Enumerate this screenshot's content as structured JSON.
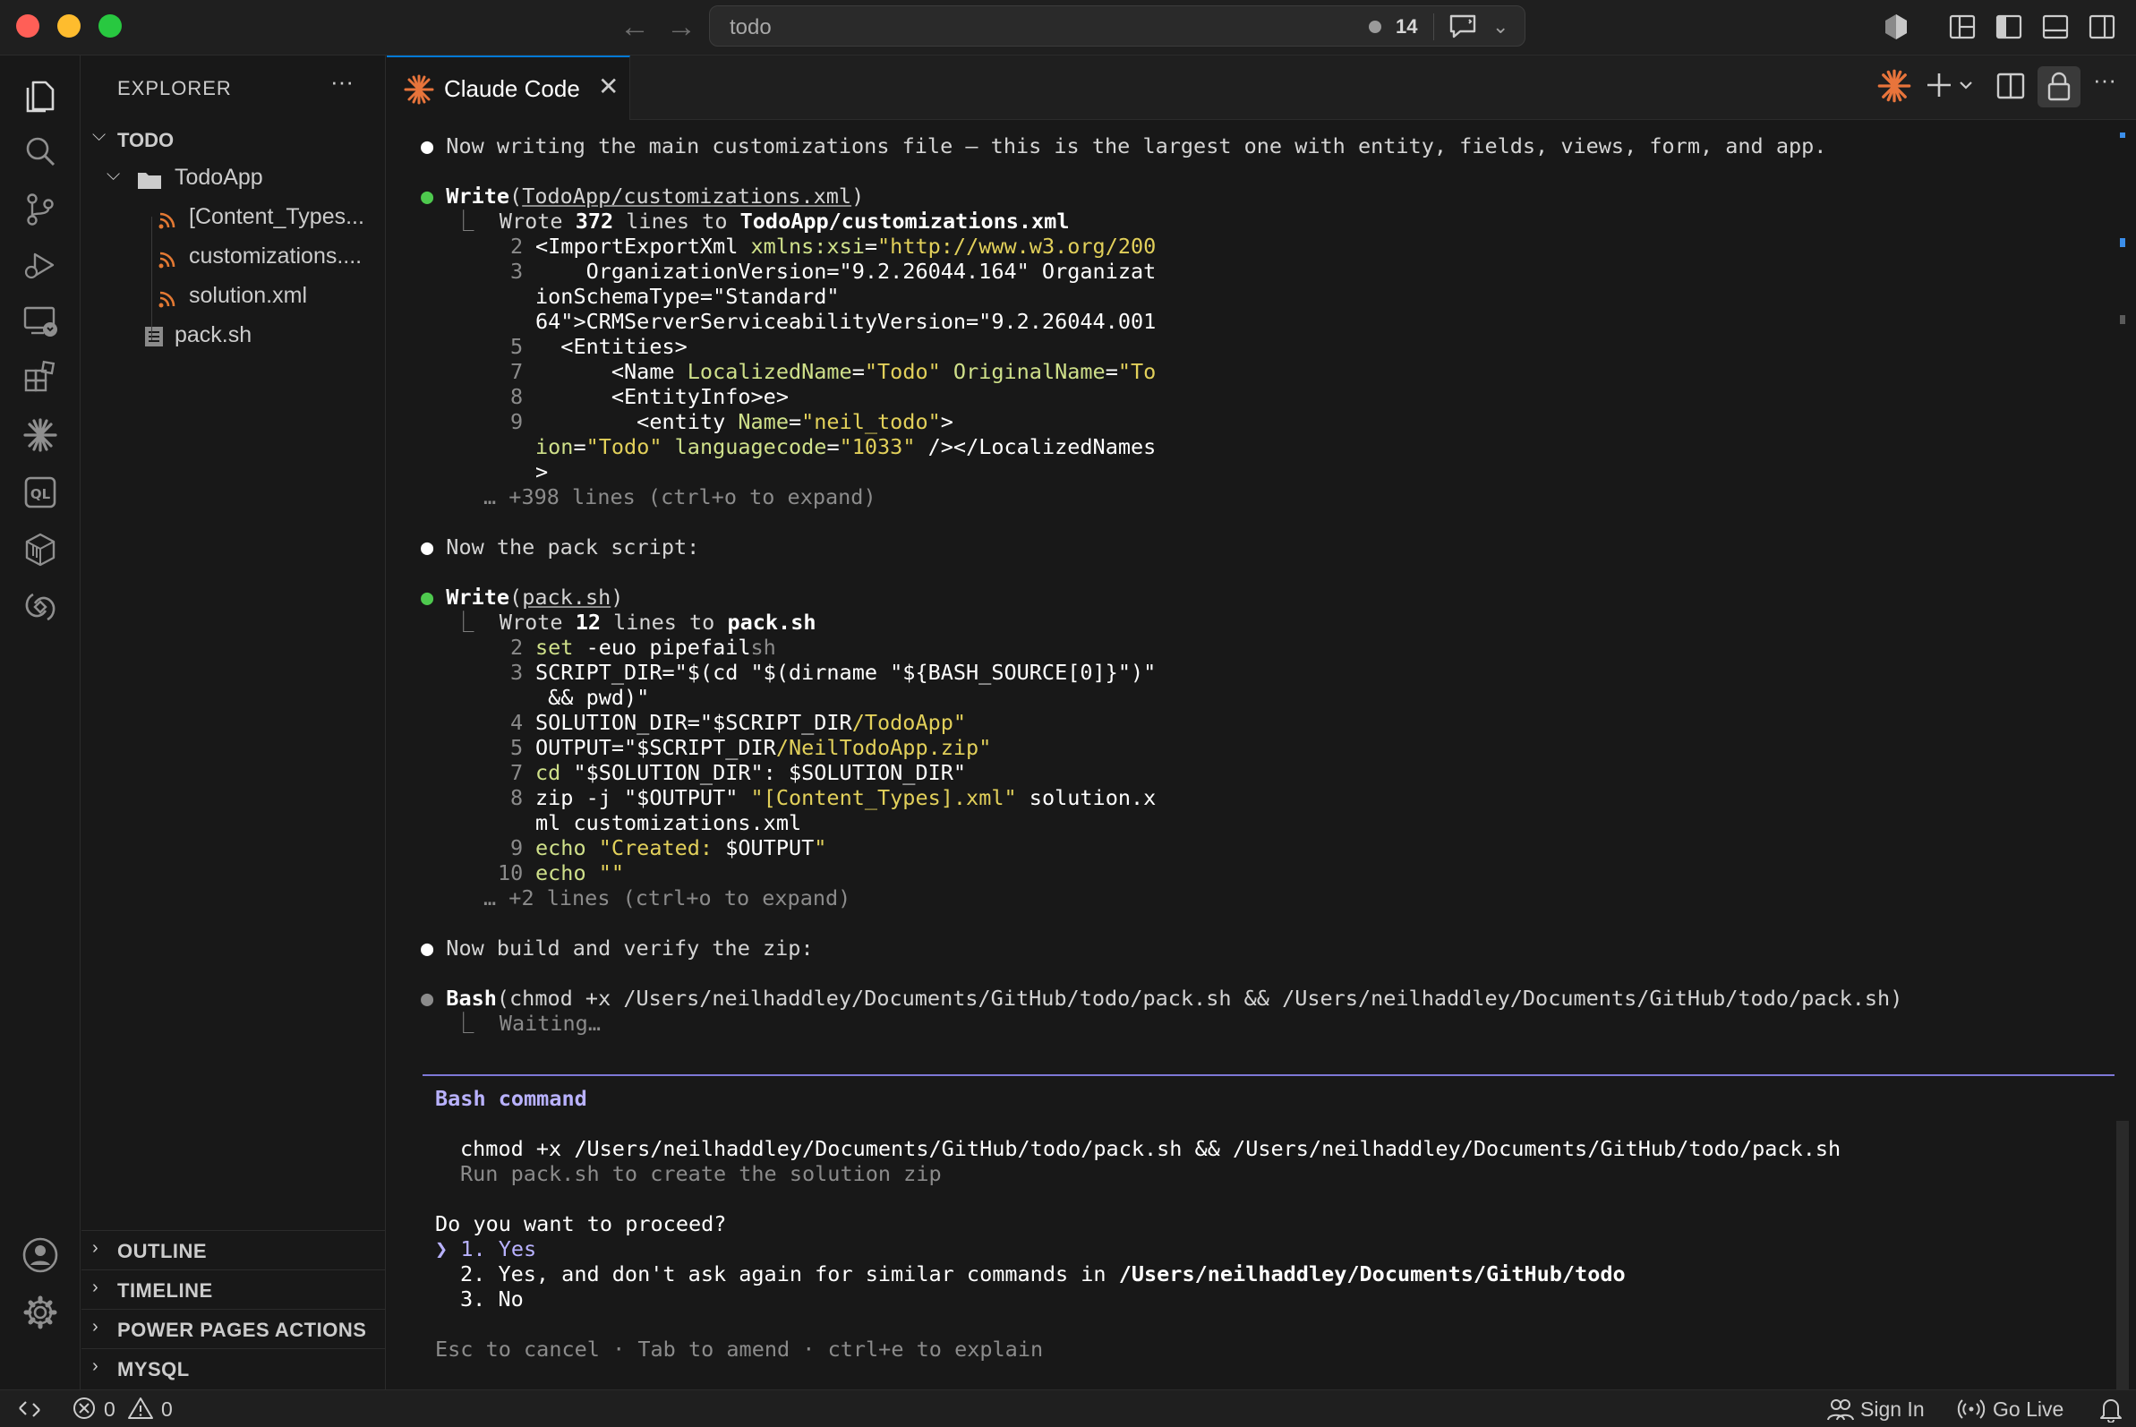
{
  "window": {
    "search_text": "todo",
    "notification_count": "14"
  },
  "sidebar": {
    "title": "EXPLORER",
    "more": "···",
    "root": "TODO",
    "folder": "TodoApp",
    "files": [
      "[Content_Types...",
      "customizations....",
      "solution.xml"
    ],
    "root_file": "pack.sh",
    "sections": [
      "OUTLINE",
      "TIMELINE",
      "POWER PAGES ACTIONS",
      "MYSQL"
    ]
  },
  "editor": {
    "tab_label": "Claude Code",
    "tab_close": "✕"
  },
  "terminal": {
    "msg1": "Now writing the main customizations file — this is the largest one with entity, fields, views, form, and app.",
    "write1_tool": "Write",
    "write1_path": "TodoApp/customizations.xml",
    "write1_summary_a": "Wrote ",
    "write1_summary_n": "372",
    "write1_summary_b": " lines to ",
    "write1_summary_f": "TodoApp/customizations.xml",
    "w1_l2_num": "2",
    "w1_l2_a": "<ImportExportXml ",
    "w1_l2_b": "xmlns:xsi",
    "w1_l2_c": "=",
    "w1_l2_d": "\"http://www.w3.org/200",
    "w1_l3_num": "3",
    "w1_l3": "    OrganizationVersion=\"9.2.26044.164\" Organizat",
    "w1_l3b": "ionSchemaType=\"Standard\"",
    "w1_l3c": "64\">CRMServerServiceabilityVersion=\"9.2.26044.001",
    "w1_l5_num": "5",
    "w1_l5": "  <Entities>",
    "w1_l7_num": "7",
    "w1_l7_a": "      <Name ",
    "w1_l7_b": "LocalizedName",
    "w1_l7_c": "=",
    "w1_l7_d": "\"Todo\"",
    "w1_l7_e": " ",
    "w1_l7_f": "OriginalName",
    "w1_l7_g": "=",
    "w1_l7_h": "\"To",
    "w1_l8_num": "8",
    "w1_l8": "      <EntityInfo>e>",
    "w1_l9_num": "9",
    "w1_l9_a": "        <entity ",
    "w1_l9_b": "Name",
    "w1_l9_c": "=",
    "w1_l9_d": "\"neil_todo\"",
    "w1_l9_e": ">",
    "w1_l9b_a": "ion",
    "w1_l9b_b": "=",
    "w1_l9b_c": "\"Todo\"",
    "w1_l9b_d": " languagecode",
    "w1_l9b_e": "=",
    "w1_l9b_f": "\"1033\"",
    "w1_l9b_g": " /></LocalizedNames",
    "w1_l9c": ">",
    "w1_more": "… +398 lines (ctrl+o to expand)",
    "msg2": "Now the pack script:",
    "write2_tool": "Write",
    "write2_path": "pack.sh",
    "write2_summary_a": "Wrote ",
    "write2_summary_n": "12",
    "write2_summary_b": " lines to ",
    "write2_summary_f": "pack.sh",
    "w2_l2_num": "2",
    "w2_l2_a": "set",
    "w2_l2_b": " -euo pipefail",
    "w2_l2_c": "sh",
    "w2_l3_num": "3",
    "w2_l3_a": "SCRIPT_DIR=\"$(cd \"$(dirname \"${BASH_SOURCE[0]}\")\"",
    "w2_l3b": " && pwd)\"",
    "w2_l4_num": "4",
    "w2_l4_a": "SOLUTION_DIR=\"$SCRIPT_DIR",
    "w2_l4_b": "/TodoApp",
    "w2_l4_c": "\"",
    "w2_l5_num": "5",
    "w2_l5_a": "OUTPUT=\"$SCRIPT_DIR",
    "w2_l5_b": "/NeilTodoApp.zip",
    "w2_l5_c": "\"",
    "w2_l7_num": "7",
    "w2_l7_a": "cd",
    "w2_l7_b": " \"$SOLUTION_DIR\": $SOLUTION_DIR\"",
    "w2_l8_num": "8",
    "w2_l8_a": "zip -j \"$OUTPUT\" ",
    "w2_l8_b": "\"[Content_Types].xml\"",
    "w2_l8_c": " solution.x",
    "w2_l8b": "ml customizations.xml",
    "w2_l9_num": "9",
    "w2_l9_a": "echo",
    "w2_l9_b": " \"Created: ",
    "w2_l9_c": "$OUTPUT",
    "w2_l9_d": "\"",
    "w2_l10_num": "10",
    "w2_l10_a": "echo",
    "w2_l10_b": " \"\"",
    "w2_more": "… +2 lines (ctrl+o to expand)",
    "msg3": "Now build and verify the zip:",
    "bash_tool": "Bash",
    "bash_cmd": "(chmod +x /Users/neilhaddley/Documents/GitHub/todo/pack.sh && /Users/neilhaddley/Documents/GitHub/todo/pack.sh)",
    "bash_wait": "Waiting…",
    "perm_title": "Bash command",
    "perm_cmd": "chmod +x /Users/neilhaddley/Documents/GitHub/todo/pack.sh && /Users/neilhaddley/Documents/GitHub/todo/pack.sh",
    "perm_desc": "Run pack.sh to create the solution zip",
    "perm_q": "Do you want to proceed?",
    "opt_cursor": "❯",
    "opt1": "1. Yes",
    "opt2_a": "2. Yes, and don't ask again for similar commands in ",
    "opt2_b": "/Users/neilhaddley/Documents/GitHub/todo",
    "opt3": "3. No",
    "footer": "Esc to cancel · Tab to amend · ctrl+e to explain"
  },
  "statusbar": {
    "errors": "0",
    "warnings": "0",
    "sign_in": "Sign In",
    "go_live": "Go Live"
  },
  "colors": {
    "accent": "#0078d4",
    "claude_orange": "#e8743b",
    "prompt_purple": "#b9b2ff"
  }
}
